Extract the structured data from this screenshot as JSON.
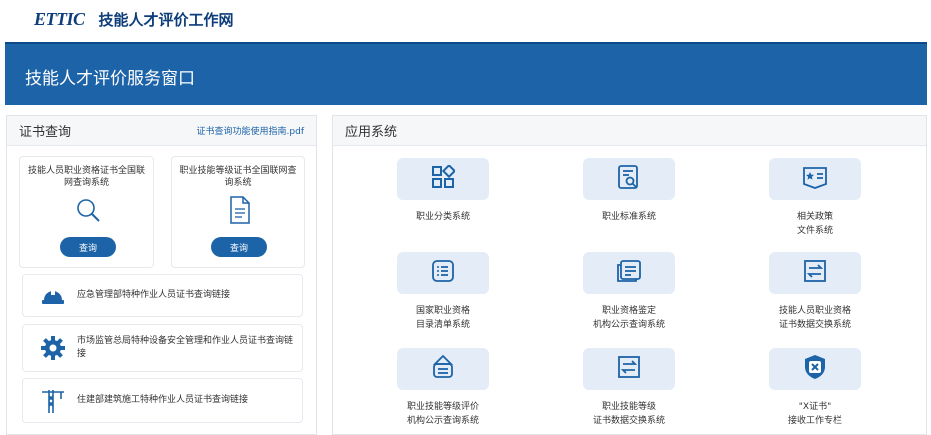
{
  "header": {
    "logo": "ETTIC",
    "site_title": "技能人才评价工作网"
  },
  "banner": {
    "title": "技能人才评价服务窗口"
  },
  "cert_panel": {
    "title": "证书查询",
    "guide_link": "证书查询功能使用指南.pdf",
    "cards": [
      {
        "title": "技能人员职业资格证书全国联网查询系统",
        "button": "查询",
        "icon": "search-icon"
      },
      {
        "title": "职业技能等级证书全国联网查询系统",
        "button": "查询",
        "icon": "document-icon"
      }
    ],
    "links": [
      {
        "label": "应急管理部特种作业人员证书查询链接",
        "icon": "helmet-icon"
      },
      {
        "label": "市场监管总局特种设备安全管理和作业人员证书查询链接",
        "icon": "gear-icon"
      },
      {
        "label": "住建部建筑施工特种作业人员证书查询链接",
        "icon": "crane-icon"
      }
    ]
  },
  "apps_panel": {
    "title": "应用系统",
    "apps": [
      {
        "line1": "职业分类系统",
        "line2": "",
        "icon": "category-icon"
      },
      {
        "line1": "职业标准系统",
        "line2": "",
        "icon": "standard-doc-icon"
      },
      {
        "line1": "相关政策",
        "line2": "文件系统",
        "icon": "policy-book-icon"
      },
      {
        "line1": "国家职业资格",
        "line2": "目录清单系统",
        "icon": "list-icon"
      },
      {
        "line1": "职业资格鉴定",
        "line2": "机构公示查询系统",
        "icon": "notice-icon"
      },
      {
        "line1": "技能人员职业资格",
        "line2": "证书数据交换系统",
        "icon": "exchange-icon"
      },
      {
        "line1": "职业技能等级评价",
        "line2": "机构公示查询系统",
        "icon": "signboard-icon"
      },
      {
        "line1": "职业技能等级",
        "line2": "证书数据交换系统",
        "icon": "exchange-icon"
      },
      {
        "line1": "\"X证书\"",
        "line2": "接收工作专栏",
        "icon": "x-cert-icon"
      }
    ]
  },
  "colors": {
    "primary": "#1d63a8",
    "dark_blue": "#0d3d7a",
    "tile_bg": "#e4edf7"
  }
}
